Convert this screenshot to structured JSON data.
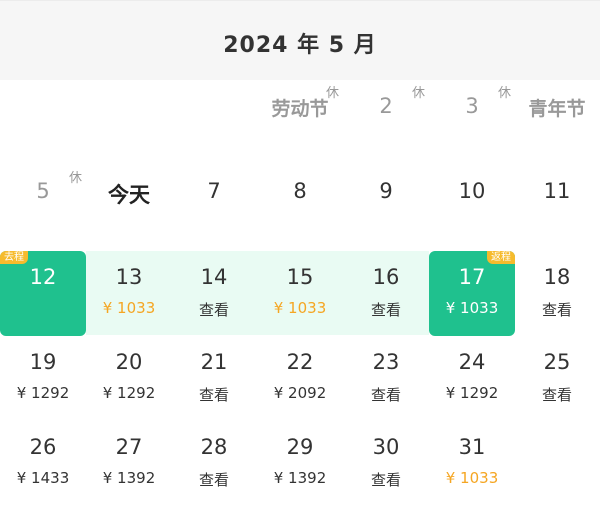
{
  "header": {
    "title": "2024 年 5 月"
  },
  "rows": [
    [
      null,
      null,
      null,
      {
        "num": "劳动节",
        "style": "fest",
        "rest": "休"
      },
      {
        "num": "2",
        "style": "gray",
        "rest": "休"
      },
      {
        "num": "3",
        "style": "gray",
        "rest": "休"
      },
      {
        "num": "青年节",
        "style": "fest"
      }
    ],
    [
      {
        "num": "5",
        "style": "gray",
        "rest": "休"
      },
      {
        "num": "今天",
        "style": "today"
      },
      {
        "num": "7"
      },
      {
        "num": "8"
      },
      {
        "num": "9"
      },
      {
        "num": "10"
      },
      {
        "num": "11"
      }
    ],
    [
      {
        "num": "12",
        "selected": true,
        "badge": "去程",
        "badgeSide": "left"
      },
      {
        "num": "13",
        "sub": "¥ 1033",
        "subStyle": "orange"
      },
      {
        "num": "14",
        "sub": "查看"
      },
      {
        "num": "15",
        "sub": "¥ 1033",
        "subStyle": "orange"
      },
      {
        "num": "16",
        "sub": "查看"
      },
      {
        "num": "17",
        "sub": "¥ 1033",
        "selected": true,
        "badge": "返程",
        "badgeSide": "right"
      },
      {
        "num": "18",
        "sub": "查看"
      }
    ],
    [
      {
        "num": "19",
        "sub": "¥ 1292"
      },
      {
        "num": "20",
        "sub": "¥ 1292"
      },
      {
        "num": "21",
        "sub": "查看"
      },
      {
        "num": "22",
        "sub": "¥ 2092"
      },
      {
        "num": "23",
        "sub": "查看"
      },
      {
        "num": "24",
        "sub": "¥ 1292"
      },
      {
        "num": "25",
        "sub": "查看"
      }
    ],
    [
      {
        "num": "26",
        "sub": "¥ 1433"
      },
      {
        "num": "27",
        "sub": "¥ 1392"
      },
      {
        "num": "28",
        "sub": "查看"
      },
      {
        "num": "29",
        "sub": "¥ 1392"
      },
      {
        "num": "30",
        "sub": "查看"
      },
      {
        "num": "31",
        "sub": "¥ 1033",
        "subStyle": "orange"
      },
      null
    ]
  ],
  "colors": {
    "selected": "#1fc18e",
    "range": "#e9fbf3",
    "price_low": "#f5a623",
    "badge": "#f6bb2d"
  }
}
